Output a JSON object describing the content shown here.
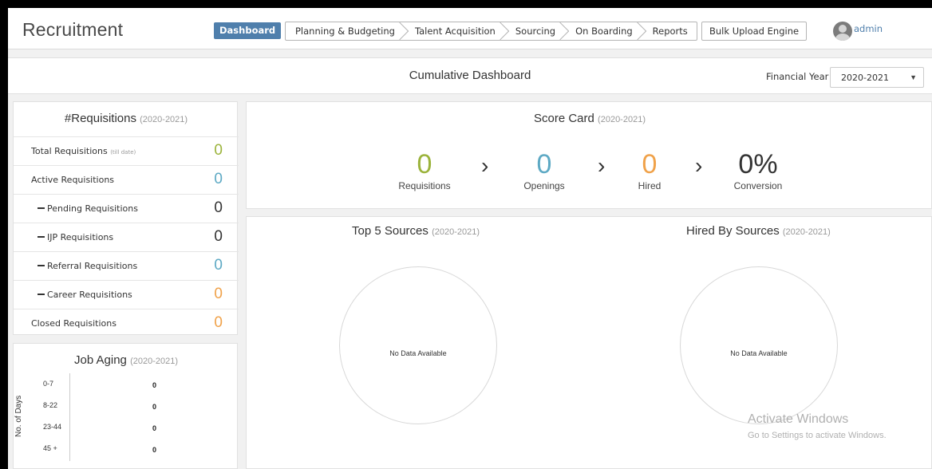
{
  "header": {
    "brand": "Recruitment",
    "nav_active": "Dashboard",
    "nav_items": [
      "Planning & Budgeting",
      "Talent Acquisition",
      "Sourcing",
      "On Boarding",
      "Reports"
    ],
    "bulk_upload": "Bulk Upload Engine",
    "user": "admin"
  },
  "titlebar": {
    "title": "Cumulative Dashboard",
    "fy_label": "Financial Year",
    "fy_value": "2020-2021"
  },
  "requisitions": {
    "title": "#Requisitions",
    "year": "(2020-2021)",
    "rows": [
      {
        "label": "Total Requisitions",
        "note": "(till date)",
        "value": "0",
        "color": "#9bb33b"
      },
      {
        "label": "Active Requisitions",
        "value": "0",
        "color": "#5da9c4"
      },
      {
        "label": "Pending Requisitions",
        "value": "0",
        "color": "#333333"
      },
      {
        "label": "IJP Requisitions",
        "value": "0",
        "color": "#333333"
      },
      {
        "label": "Referral Requisitions",
        "value": "0",
        "color": "#5da9c4"
      },
      {
        "label": "Career Requisitions",
        "value": "0",
        "color": "#f0a24a"
      },
      {
        "label": "Closed Requisitions",
        "value": "0",
        "color": "#f0a24a"
      }
    ]
  },
  "job_aging": {
    "title": "Job Aging",
    "year": "(2020-2021)",
    "ylabel": "No. of Days",
    "categories": [
      "0-7",
      "8-22",
      "23-44",
      "45 +"
    ],
    "values": [
      "0",
      "0",
      "0",
      "0"
    ]
  },
  "scorecard": {
    "title": "Score Card",
    "year": "(2020-2021)",
    "items": [
      {
        "value": "0",
        "label": "Requisitions",
        "color": "#9bb33b"
      },
      {
        "value": "0",
        "label": "Openings",
        "color": "#5da9c4"
      },
      {
        "value": "0",
        "label": "Hired",
        "color": "#f0a24a"
      },
      {
        "value": "0%",
        "label": "Conversion",
        "color": "#333333"
      }
    ],
    "separator": "›"
  },
  "top_sources": {
    "title": "Top 5 Sources",
    "year": "(2020-2021)",
    "empty": "No Data Available"
  },
  "hired_sources": {
    "title": "Hired By Sources",
    "year": "(2020-2021)",
    "empty": "No Data Available"
  },
  "watermark": {
    "line1": "Activate Windows",
    "line2": "Go to Settings to activate Windows."
  }
}
